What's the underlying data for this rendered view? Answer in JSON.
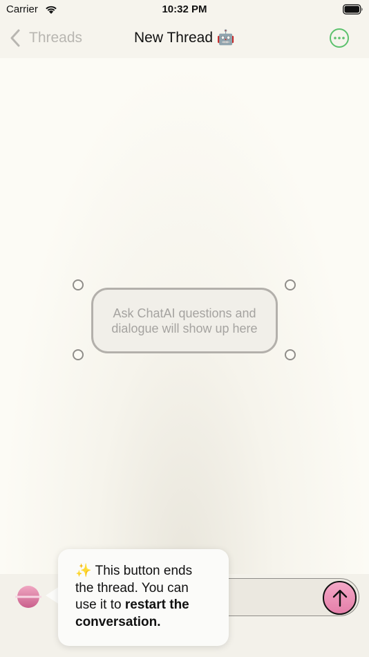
{
  "status_bar": {
    "carrier": "Carrier",
    "time": "10:32 PM"
  },
  "nav": {
    "back_label": "Threads",
    "title": "New Thread 🤖",
    "accent_color": "#5cc16d"
  },
  "thread": {
    "empty_placeholder": "Ask ChatAI questions and dialogue will show up here"
  },
  "input": {
    "value": "",
    "placeholder": ""
  },
  "tooltip": {
    "emoji": "✨",
    "text_before": " This button ends the thread. You can use it to ",
    "text_bold": "restart the conversation."
  },
  "icons": {
    "back": "chevron-left-icon",
    "more": "ellipsis-circle-icon",
    "end_thread": "planet-icon",
    "send": "arrow-up-icon"
  }
}
